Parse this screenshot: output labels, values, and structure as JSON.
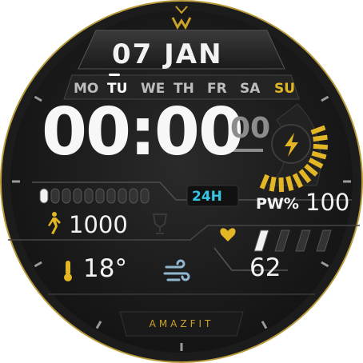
{
  "date": {
    "text": "07 JAN"
  },
  "weekdays": [
    {
      "label": "MO",
      "state": "normal"
    },
    {
      "label": "TU",
      "state": "active"
    },
    {
      "label": "WE",
      "state": "normal"
    },
    {
      "label": "TH",
      "state": "normal"
    },
    {
      "label": "FR",
      "state": "normal"
    },
    {
      "label": "SA",
      "state": "normal"
    },
    {
      "label": "SU",
      "state": "weekend"
    }
  ],
  "time": {
    "hours_minutes": "00:00",
    "seconds": "00",
    "format": "24H"
  },
  "battery": {
    "label": "PW%",
    "value": "100",
    "level": 1.0
  },
  "steps": {
    "value": "1000",
    "progress_segments_lit": 1,
    "progress_segments_total": 10
  },
  "weather": {
    "temperature": "18°",
    "icon": "wind-icon"
  },
  "heart_rate": {
    "value": "62",
    "bar_segments_lit": 1,
    "bar_segments_total": 4
  },
  "brand": {
    "text": "AMAZFIT"
  },
  "logo": {
    "text": "M"
  },
  "colors": {
    "accent_gold": "#e2b624",
    "accent_cyan": "#35c6e6",
    "text": "#f2f2f2",
    "bezel": "#141414"
  }
}
